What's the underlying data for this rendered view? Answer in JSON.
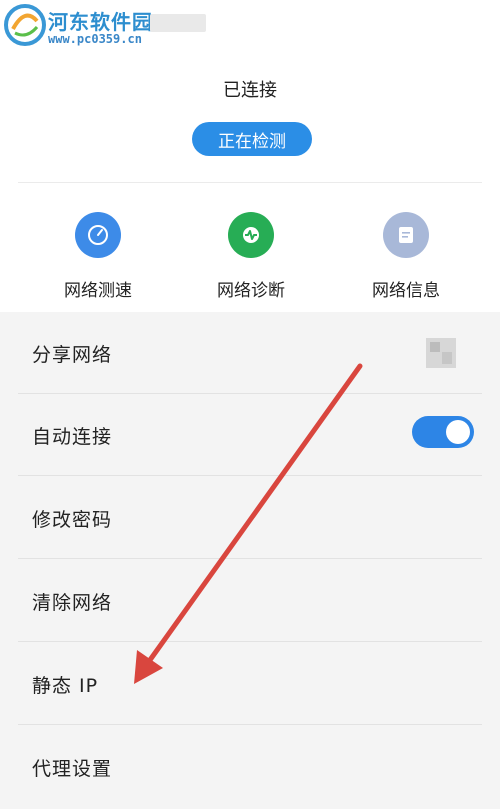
{
  "watermark": {
    "title": "河东软件园",
    "url": "www.pc0359.cn"
  },
  "status": {
    "text": "已连接"
  },
  "detect_button": {
    "label": "正在检测"
  },
  "tools": [
    {
      "label": "网络测速",
      "icon": "speedometer-icon",
      "color": "#3d8be8"
    },
    {
      "label": "网络诊断",
      "icon": "pulse-icon",
      "color": "#27ad55"
    },
    {
      "label": "网络信息",
      "icon": "document-icon",
      "color": "#a8b8d8"
    }
  ],
  "menu": [
    {
      "label": "分享网络"
    },
    {
      "label": "自动连接",
      "toggle": true
    },
    {
      "label": "修改密码"
    },
    {
      "label": "清除网络"
    },
    {
      "label": "静态 IP"
    },
    {
      "label": "代理设置"
    }
  ],
  "colors": {
    "accent": "#2b8ee6",
    "annotation_arrow": "#d9463e"
  }
}
